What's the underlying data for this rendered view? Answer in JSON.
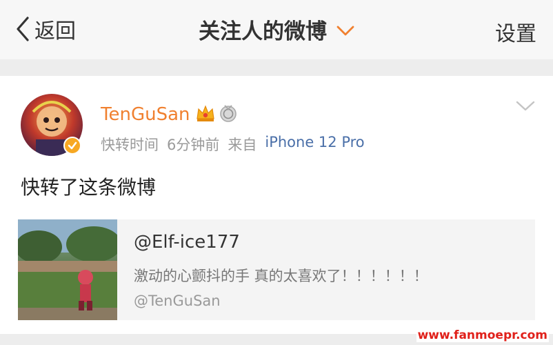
{
  "navbar": {
    "back_label": "返回",
    "title": "关注人的微博",
    "settings_label": "设置"
  },
  "post": {
    "username": "TenGuSan",
    "meta": {
      "type": "快转时间",
      "time": "6分钟前",
      "from_prefix": "来自",
      "source": "iPhone 12 Pro"
    },
    "text": "快转了这条微博",
    "quote": {
      "author": "@Elf-ice177",
      "text": "激动的心颤抖的手  真的太喜欢了！！！！！！",
      "sub": "@TenGuSan"
    }
  },
  "watermark": "www.fanmoepr.com",
  "colors": {
    "accent": "#f0802f",
    "link": "#4a6fa8",
    "watermark": "#e0201a"
  }
}
